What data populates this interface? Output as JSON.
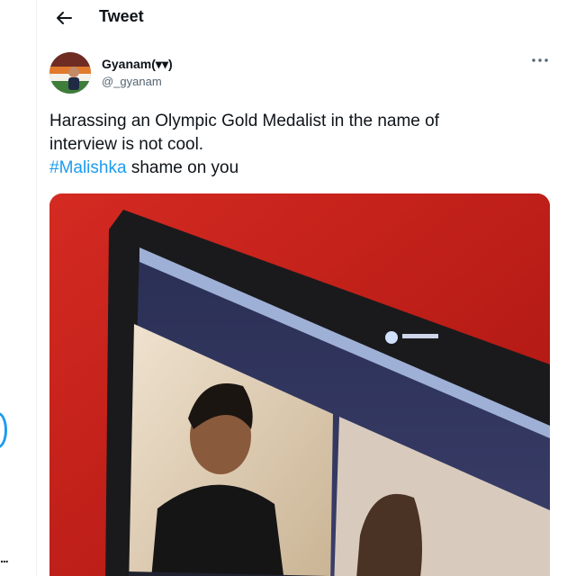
{
  "header": {
    "title": "Tweet",
    "back_icon": "arrow-left-icon"
  },
  "sidebar": {
    "more_dots": "..."
  },
  "tweet": {
    "display_name": "Gyanam(▾▾)",
    "handle": "@_gyanam",
    "more_icon": "more-horizontal-icon",
    "text_line1": "Harassing an Olympic Gold Medalist in the name of",
    "text_line2": "interview is not cool.",
    "hashtag": "#Malishka",
    "text_line3_rest": " shame on you"
  },
  "colors": {
    "link": "#1d9bf0",
    "text": "#0f1419",
    "muted": "#536471",
    "media_background": "#c41818"
  }
}
